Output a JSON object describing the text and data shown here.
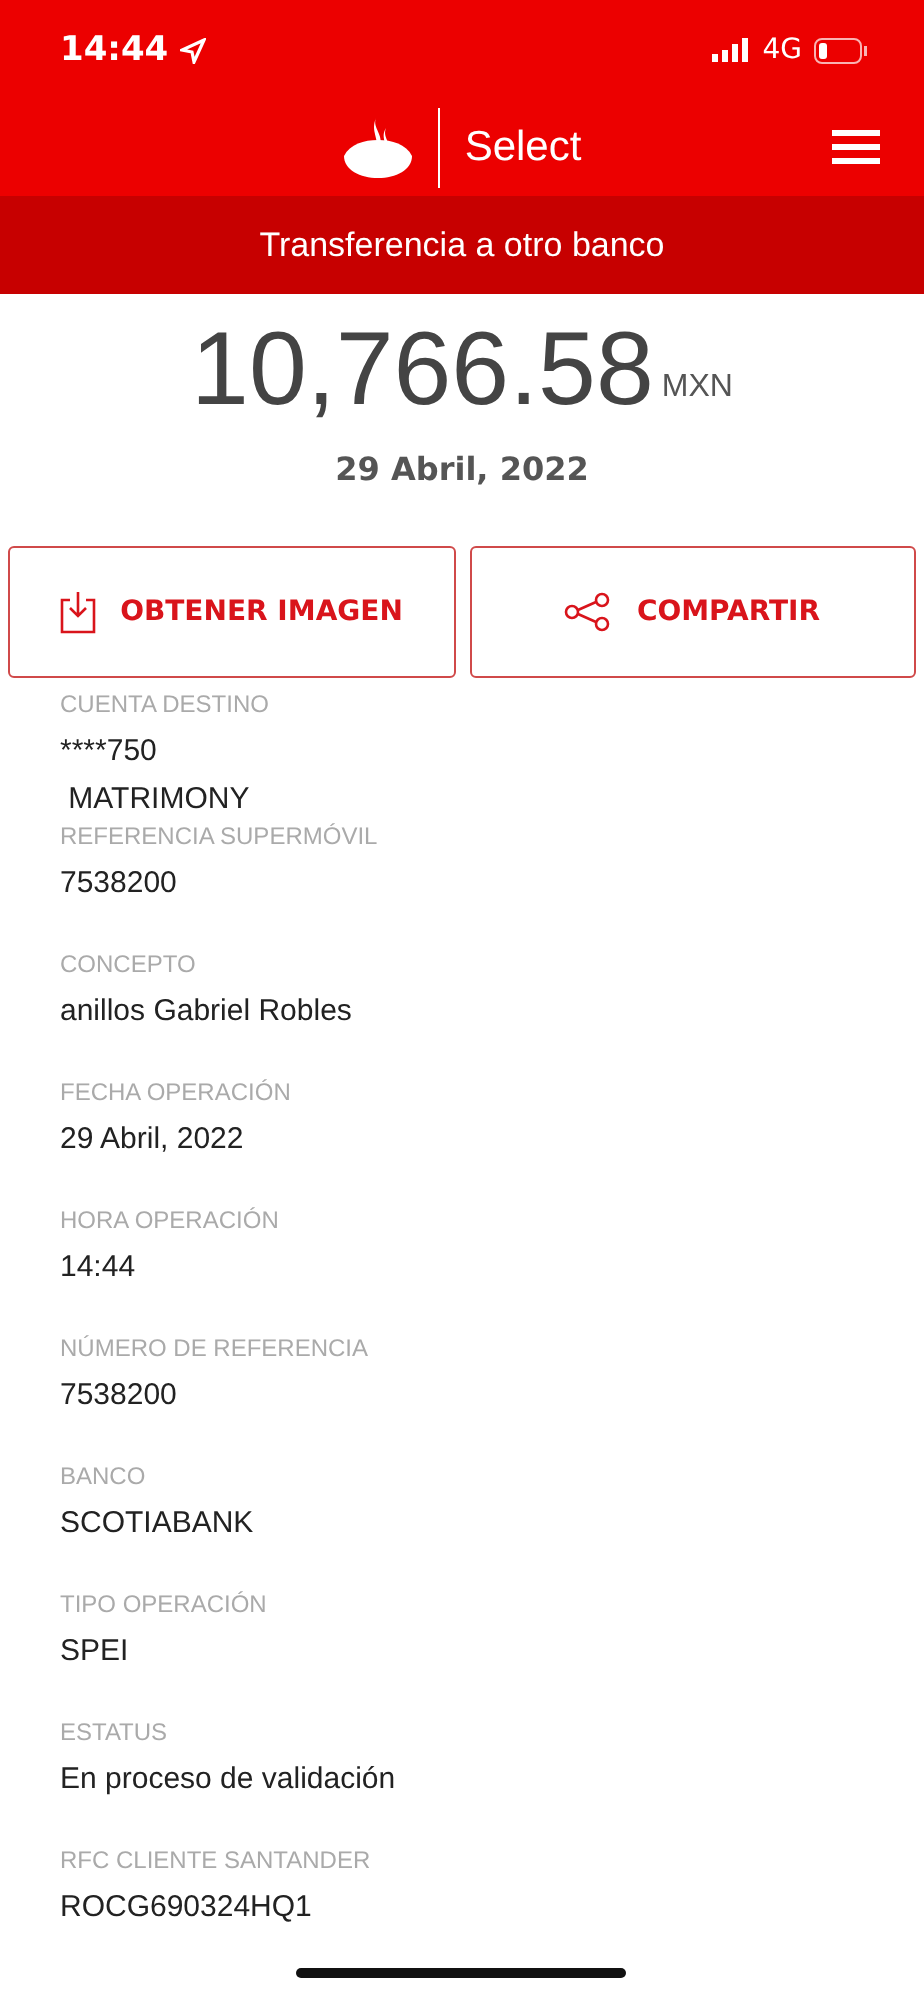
{
  "status_bar": {
    "time": "14:44",
    "network": "4G"
  },
  "header": {
    "brand": "Select"
  },
  "subtitle": "Transferencia a otro banco",
  "amount": {
    "value": "10,766.58",
    "currency": "MXN",
    "date": "29 Abril, 2022"
  },
  "actions": [
    {
      "label": "OBTENER IMAGEN",
      "kind": "download"
    },
    {
      "label": "COMPARTIR",
      "kind": "share"
    }
  ],
  "fields": [
    {
      "label": "CUENTA DESTINO",
      "values": [
        "****750",
        " MATRIMONY"
      ]
    },
    {
      "label": "REFERENCIA SUPERMÓVIL",
      "values": [
        "7538200"
      ]
    },
    {
      "label": "CONCEPTO",
      "values": [
        "anillos Gabriel Robles"
      ]
    },
    {
      "label": "FECHA OPERACIÓN",
      "values": [
        "29 Abril, 2022"
      ]
    },
    {
      "label": "HORA OPERACIÓN",
      "values": [
        "14:44"
      ]
    },
    {
      "label": "NÚMERO DE REFERENCIA",
      "values": [
        "7538200"
      ]
    },
    {
      "label": "BANCO",
      "values": [
        "SCOTIABANK"
      ]
    },
    {
      "label": "TIPO OPERACIÓN",
      "values": [
        "SPEI"
      ]
    },
    {
      "label": "ESTATUS",
      "values": [
        "En proceso de validación"
      ]
    },
    {
      "label": "RFC CLIENTE SANTANDER",
      "values": [
        "ROCG690324HQ1"
      ]
    }
  ]
}
